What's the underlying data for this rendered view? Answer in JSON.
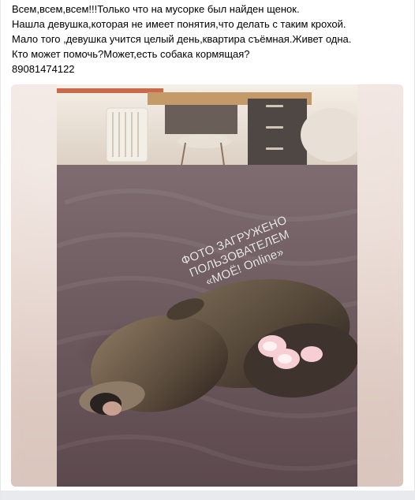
{
  "post": {
    "lines": [
      "Всем,всем,всем!!!Только что на мусорке был найден щенок.",
      "Нашла девушка,которая не имеет понятия,что делать с таким крохой.",
      "Мало того ,девушка учится целый день,квартира съёмная.Живет одна.",
      "Кто может помочь?Может,есть собака кормящая?",
      "89081474122"
    ]
  },
  "photo": {
    "watermark_line_1": "ФОТО ЗАГРУЖЕНО ПОЛЬЗОВАТЕЛЕМ",
    "watermark_line_2": "«МОЁ! Online»"
  }
}
